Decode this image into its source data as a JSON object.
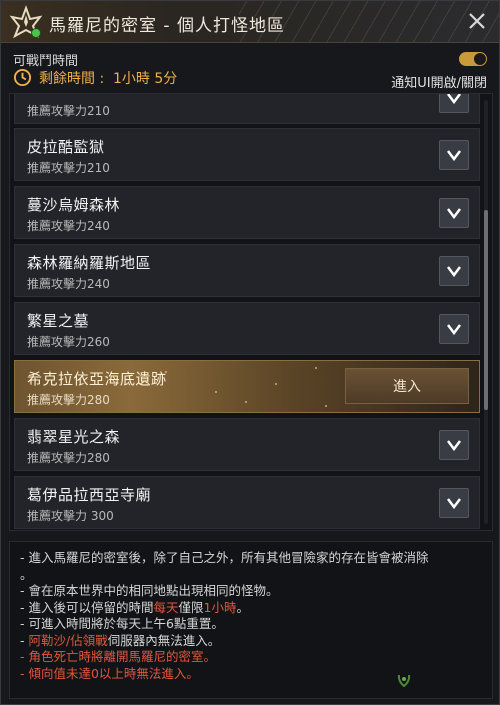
{
  "window": {
    "title": "馬羅尼的密室 - 個人打怪地區"
  },
  "status": {
    "available_label": "可戰鬥時間",
    "remaining_label": "剩餘時間 :",
    "remaining_value": "1小時 5分",
    "notify_label": "通知UI開啟/關閉",
    "notify_on": true
  },
  "dungeons": [
    {
      "name": "",
      "power": "推薦攻擊力210"
    },
    {
      "name": "皮拉酷監獄",
      "power": "推薦攻擊力210"
    },
    {
      "name": "蔓沙烏姆森林",
      "power": "推薦攻擊力240"
    },
    {
      "name": "森林羅納羅斯地區",
      "power": "推薦攻擊力240"
    },
    {
      "name": "繁星之墓",
      "power": "推薦攻擊力260"
    },
    {
      "name": "希克拉依亞海底遺跡",
      "power": "推薦攻擊力280",
      "action": "進入"
    },
    {
      "name": "翡翠星光之森",
      "power": "推薦攻擊力280"
    },
    {
      "name": "葛伊品拉西亞寺廟",
      "power": "推薦攻擊力 300"
    }
  ],
  "notes": {
    "n1": "- 進入馬羅尼的密室後，除了自己之外，所有其他冒險家的存在皆會被消除",
    "n1b": "。",
    "n2": "- 會在原本世界中的相同地點出現相同的怪物。",
    "n3a": "- 進入後可以停留的時間",
    "n3b": "每天",
    "n3c": "僅限",
    "n3d": "1小時",
    "n3e": "。",
    "n4": "- 可進入時間將於每天上午6點重置。",
    "n5a": "- ",
    "n5b": "阿勒沙/佔領戰",
    "n5c": "伺服器內無法進入。",
    "n6": "- 角色死亡時將離開馬羅尼的密室。",
    "n7": "- 傾向值未達0以上時無法進入。"
  },
  "colors": {
    "accent_gold": "#f0b04a",
    "warning_red": "#e0573e"
  }
}
